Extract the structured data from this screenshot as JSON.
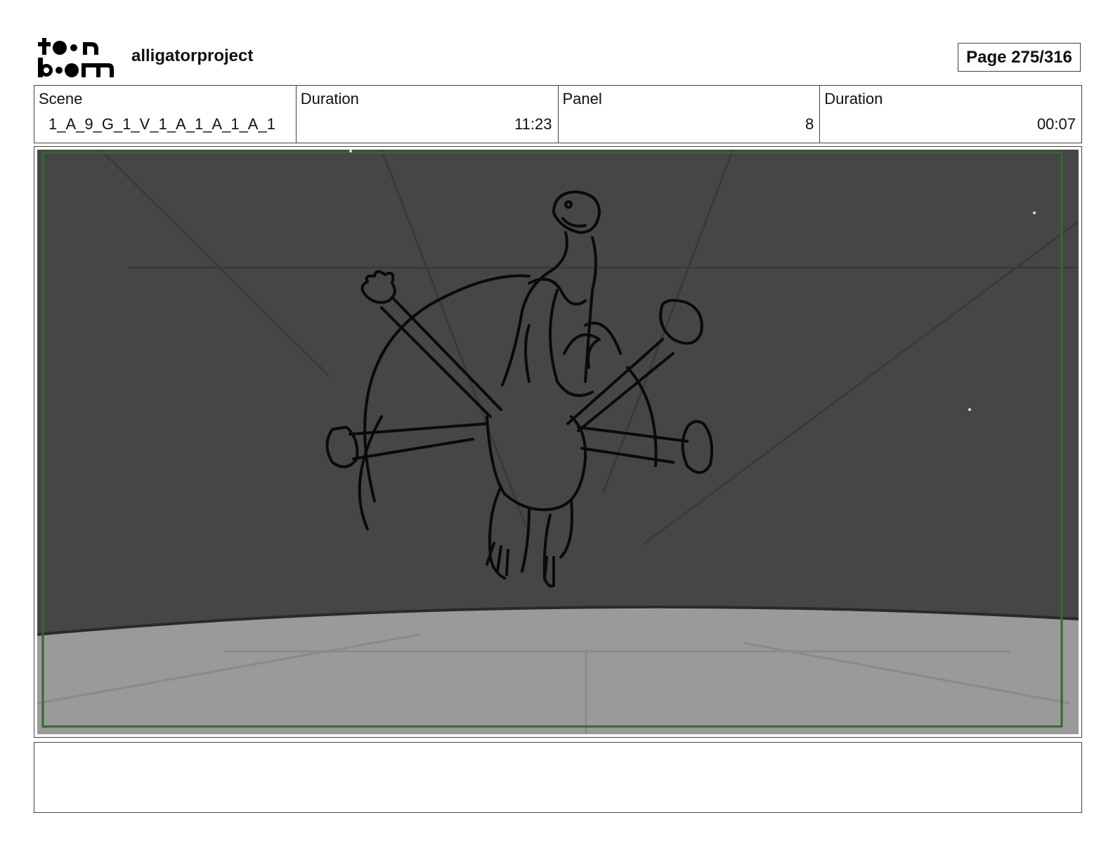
{
  "header": {
    "logo": {
      "line1": "toon",
      "line2": "boom"
    },
    "project_name": "alligatorproject",
    "page_indicator": "Page 275/316"
  },
  "info": {
    "scene_label": "Scene",
    "scene_value": "1_A_9_G_1_V_1_A_1_A_1_A_1",
    "scene_duration_label": "Duration",
    "scene_duration_value": "11:23",
    "panel_label": "Panel",
    "panel_value": "8",
    "panel_duration_label": "Duration",
    "panel_duration_value": "00:07"
  },
  "panel_image": {
    "icon": "storyboard-sketch",
    "colors": {
      "wall": "#464646",
      "floor": "#9a9a9a",
      "safe_frame": "#2e6b2e",
      "ink": "#0a0a0a"
    }
  },
  "notes": {
    "text": ""
  }
}
